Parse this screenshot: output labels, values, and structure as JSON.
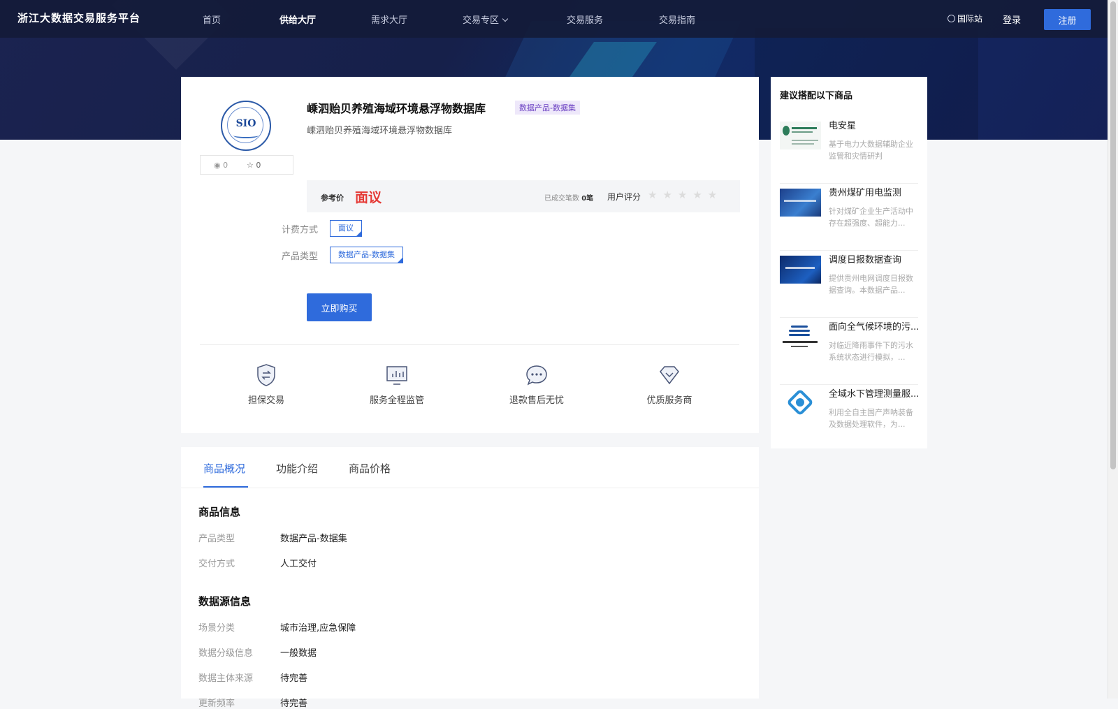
{
  "nav": {
    "logo": "浙江大数据交易服务平台",
    "items": [
      "首页",
      "供给大厅",
      "需求大厅",
      "交易专区",
      "交易服务",
      "交易指南"
    ],
    "active": "供给大厅",
    "international": "国际站",
    "login": "登录",
    "register": "注册"
  },
  "product": {
    "logo_text": "SIO",
    "views": "0",
    "favorites": "0",
    "title": "嵊泗贻贝养殖海域环境悬浮物数据库",
    "tag": "数据产品-数据集",
    "subtitle": "嵊泗贻贝养殖海域环境悬浮物数据库",
    "price_label": "参考价",
    "price": "面议",
    "deals_label": "已成交笔数",
    "deals_count": "0笔",
    "rating_label": "用户评分",
    "rating_stars": "★★★★★",
    "rating_value": 0,
    "billing_label": "计费方式",
    "billing_value": "面议",
    "type_label": "产品类型",
    "type_value": "数据产品-数据集",
    "buy_label": "立即购买"
  },
  "features": [
    {
      "label": "担保交易",
      "icon": "shield-exchange-icon"
    },
    {
      "label": "服务全程监管",
      "icon": "monitor-chart-icon"
    },
    {
      "label": "退款售后无忧",
      "icon": "chat-bubble-icon"
    },
    {
      "label": "优质服务商",
      "icon": "diamond-icon"
    }
  ],
  "tabs": [
    "商品概况",
    "功能介绍",
    "商品价格"
  ],
  "active_tab": "商品概况",
  "info": {
    "section1_title": "商品信息",
    "rows1": [
      {
        "label": "产品类型",
        "value": "数据产品-数据集"
      },
      {
        "label": "交付方式",
        "value": "人工交付"
      }
    ],
    "section2_title": "数据源信息",
    "rows2": [
      {
        "label": "场景分类",
        "value": "城市治理,应急保障"
      },
      {
        "label": "数据分级信息",
        "value": "一般数据"
      },
      {
        "label": "数据主体来源",
        "value": "待完善"
      },
      {
        "label": "更新频率",
        "value": "待完善"
      }
    ]
  },
  "sidebar": {
    "title": "建议搭配以下商品",
    "items": [
      {
        "name": "电安星",
        "desc": "基于电力大数据辅助企业监管和灾情研判"
      },
      {
        "name": "贵州煤矿用电监测",
        "desc": "针对煤矿企业生产活动中存在超强度、超能力..."
      },
      {
        "name": "调度日报数据查询",
        "desc": "提供贵州电网调度日报数据查询。本数据产品..."
      },
      {
        "name": "面向全气候环境的污...",
        "desc": "对临近降雨事件下的污水系统状态进行模拟，..."
      },
      {
        "name": "全域水下管理测量服...",
        "desc": "利用全自主国产声呐装备及数据处理软件，为..."
      }
    ]
  },
  "colors": {
    "accent": "#2f6bdc",
    "price_red": "#e53935",
    "header_bg": "#1b2350"
  }
}
